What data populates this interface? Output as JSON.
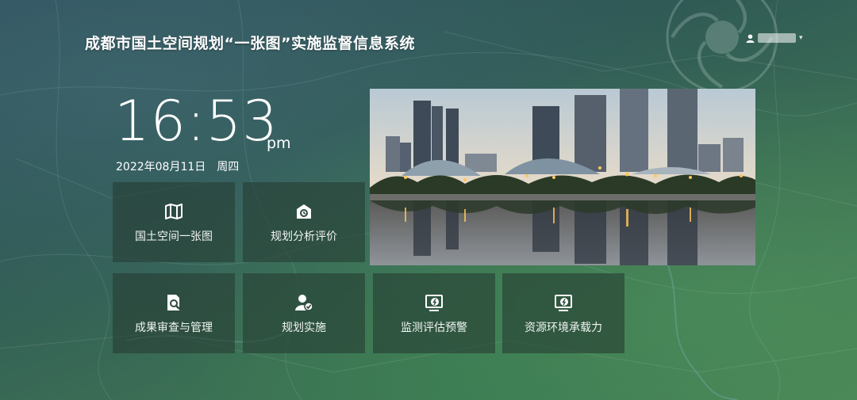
{
  "header": {
    "title": "成都市国土空间规划“一张图”实施监督信息系统"
  },
  "user": {
    "icon": "user-icon",
    "caret": "▾"
  },
  "clock": {
    "time": "16:53",
    "ampm": "pm",
    "date": "2022年08月11日",
    "weekday": "周四"
  },
  "tiles": [
    {
      "label": "国土空间一张图",
      "icon": "map-icon"
    },
    {
      "label": "规划分析评价",
      "icon": "analysis-icon"
    },
    {
      "label": "成果审查与管理",
      "icon": "document-search-icon"
    },
    {
      "label": "规划实施",
      "icon": "user-check-icon"
    },
    {
      "label": "监测评估预警",
      "icon": "monitor-alert-icon"
    },
    {
      "label": "资源环境承载力",
      "icon": "capacity-icon"
    }
  ],
  "colors": {
    "tile_bg": "#263e34",
    "bg_top": "#2d4f5c",
    "bg_bottom": "#4a8458"
  }
}
